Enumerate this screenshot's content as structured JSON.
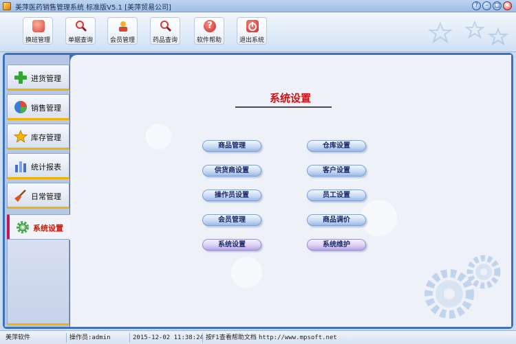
{
  "window": {
    "title": "美萍医药销售管理系统 标准版V5.1 [美萍贸易公司]",
    "controls": [
      "?",
      "–",
      "□",
      "×"
    ]
  },
  "toolbar": [
    {
      "label": "换班管理",
      "icon": "shift-change-icon",
      "color": "#d8453b"
    },
    {
      "label": "单据查询",
      "icon": "magnifier-icon",
      "color": "#e0524a"
    },
    {
      "label": "会员管理",
      "icon": "member-card-icon",
      "color": "#d44a2e"
    },
    {
      "label": "药品查询",
      "icon": "pill-search-icon",
      "color": "#d43a3a"
    },
    {
      "label": "软件帮助",
      "icon": "help-icon",
      "color": "#c8282a"
    },
    {
      "label": "退出系统",
      "icon": "exit-icon",
      "color": "#c8282a"
    }
  ],
  "sidebar": {
    "items": [
      {
        "label": "进货管理",
        "icon": "plus-icon",
        "color": "#2ea82e"
      },
      {
        "label": "销售管理",
        "icon": "pie-chart-icon",
        "color": "#3a7bd5"
      },
      {
        "label": "库存管理",
        "icon": "star-icon",
        "color": "#f5b400"
      },
      {
        "label": "统计报表",
        "icon": "bar-chart-icon",
        "color": "#4a6fc9"
      },
      {
        "label": "日常管理",
        "icon": "broom-icon",
        "color": "#d9531e"
      },
      {
        "label": "系统设置",
        "icon": "gear-icon",
        "color": "#4caf50",
        "active": true
      }
    ]
  },
  "content": {
    "title": "系统设置",
    "left_buttons": [
      "商品管理",
      "供货商设置",
      "操作员设置",
      "会员管理",
      "系统设置"
    ],
    "right_buttons": [
      "仓库设置",
      "客户设置",
      "员工设置",
      "商品调价",
      "系统维护"
    ]
  },
  "status": {
    "company": "美萍软件",
    "operator": "操作员:admin",
    "datetime": "2015-12-02 11:38:24",
    "help": "按F1查看帮助文档",
    "url": "http://www.mpsoft.net"
  }
}
